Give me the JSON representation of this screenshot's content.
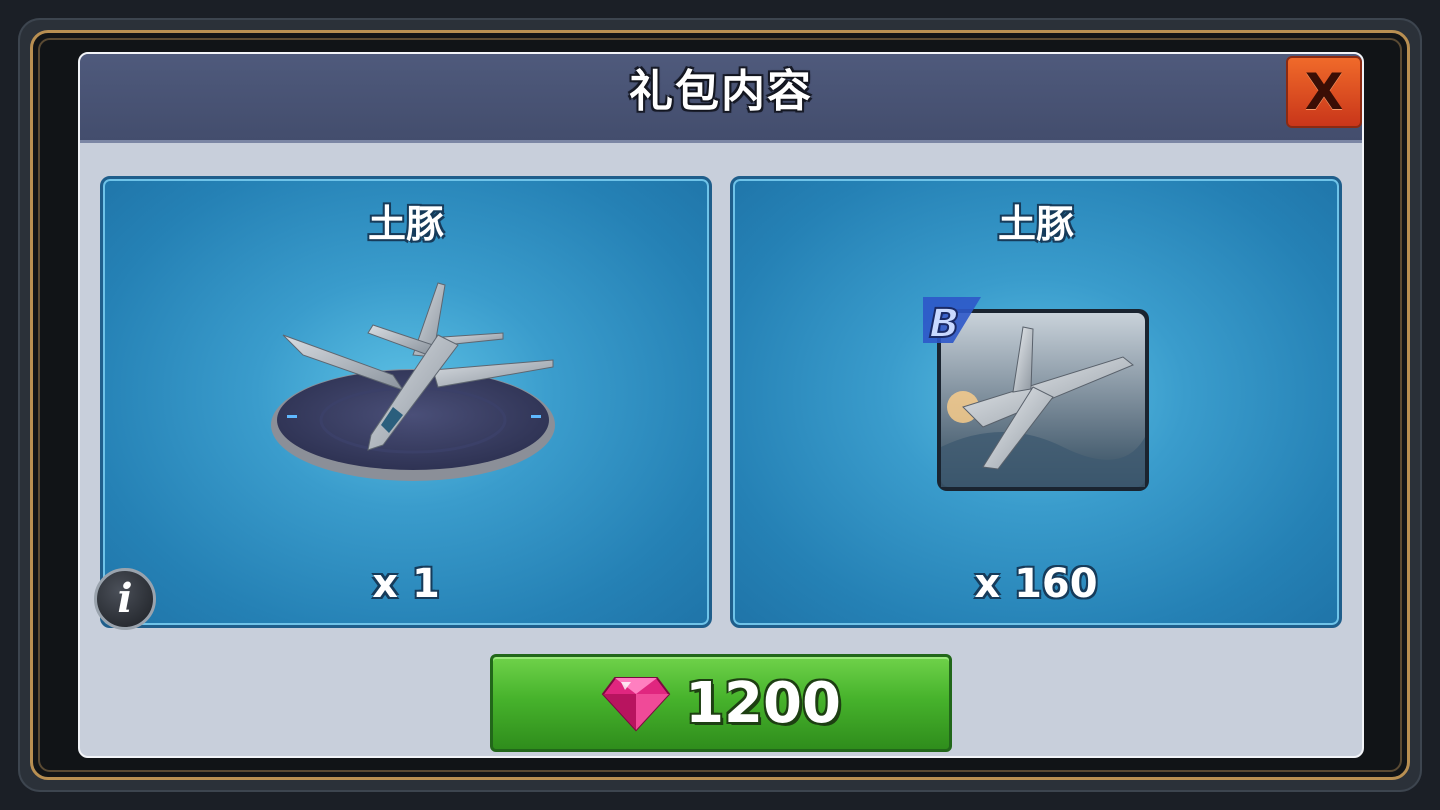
{
  "dialog": {
    "title": "礼包内容",
    "close_label": "X"
  },
  "items": [
    {
      "name": "土豚",
      "quantity": "x 1",
      "icon": "jet-on-platform-icon"
    },
    {
      "name": "土豚",
      "quantity": "x 160",
      "icon": "blueprint-card-icon",
      "badge": "B"
    }
  ],
  "info_label": "i",
  "purchase": {
    "price": "1200",
    "currency_icon": "gem-icon",
    "color": "#47b32c"
  }
}
